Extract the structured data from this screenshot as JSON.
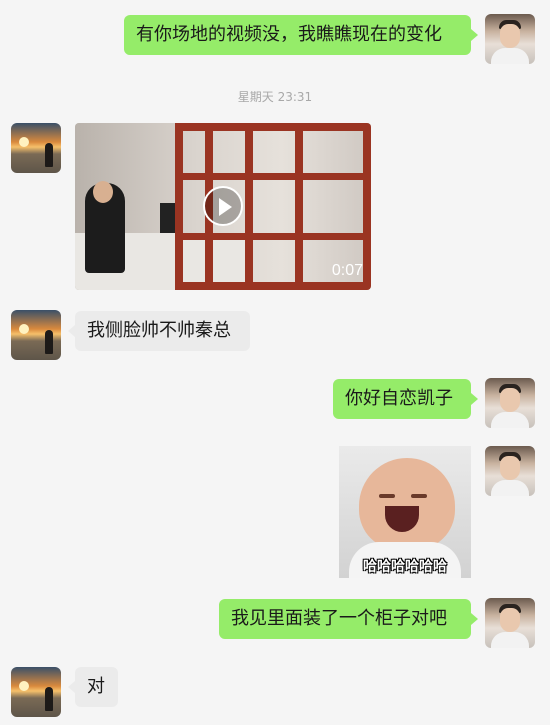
{
  "timestamp": "星期天 23:31",
  "messages": [
    {
      "type": "text",
      "text": "有你场地的视频没，我瞧瞧现在的变化"
    },
    {
      "type": "video",
      "duration": "0:07"
    },
    {
      "type": "text",
      "text": "我侧脸帅不帅秦总"
    },
    {
      "type": "text",
      "text": "你好自恋凯子"
    },
    {
      "type": "sticker",
      "caption": "哈哈哈哈哈哈"
    },
    {
      "type": "text",
      "text": "我见里面装了一个柜子对吧"
    },
    {
      "type": "text",
      "text": "对"
    }
  ]
}
